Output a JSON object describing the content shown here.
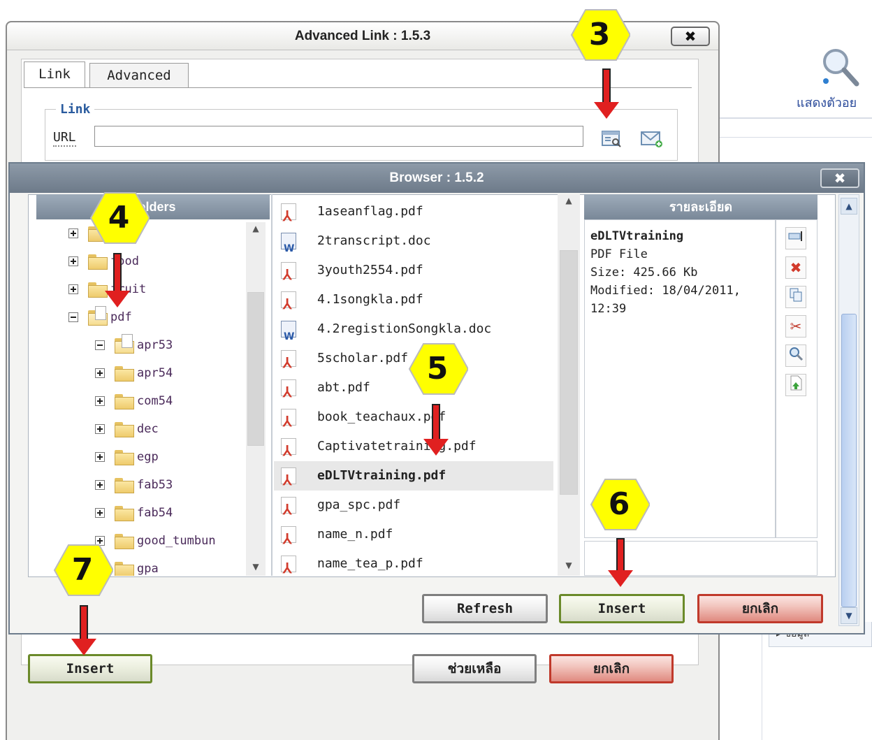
{
  "background": {
    "search_label": "แสดงตัวอย",
    "panel_tab": "ข้อมูล"
  },
  "outer_dialog": {
    "title": "Advanced Link : 1.5.3",
    "close_label": "✖",
    "tabs": [
      {
        "label": "Link"
      },
      {
        "label": "Advanced"
      }
    ],
    "fieldset_legend": "Link",
    "url_label": "URL",
    "url_value": "",
    "insert_label": "Insert",
    "help_label": "ช่วยเหลือ",
    "cancel_label": "ยกเลิก"
  },
  "browser": {
    "title": "Browser : 1.5.2",
    "close_label": "✖",
    "folders_header": "Folders",
    "details_header": "รายละเอียด",
    "tree": [
      {
        "label": "",
        "state": "plus",
        "level": 0
      },
      {
        "label": "food",
        "state": "plus",
        "level": 0
      },
      {
        "label": "fruit",
        "state": "plus",
        "level": 0
      },
      {
        "label": "pdf",
        "state": "minus",
        "level": 0
      },
      {
        "label": "apr53",
        "state": "minus",
        "level": 1
      },
      {
        "label": "apr54",
        "state": "plus",
        "level": 1
      },
      {
        "label": "com54",
        "state": "plus",
        "level": 1
      },
      {
        "label": "dec",
        "state": "plus",
        "level": 1
      },
      {
        "label": "egp",
        "state": "plus",
        "level": 1
      },
      {
        "label": "fab53",
        "state": "plus",
        "level": 1
      },
      {
        "label": "fab54",
        "state": "plus",
        "level": 1
      },
      {
        "label": "good_tumbun",
        "state": "plus",
        "level": 1
      },
      {
        "label": "gpa",
        "state": "plus",
        "level": 1
      }
    ],
    "files": [
      {
        "name": "1aseanflag.pdf",
        "type": "pdf"
      },
      {
        "name": "2transcript.doc",
        "type": "doc"
      },
      {
        "name": "3youth2554.pdf",
        "type": "pdf"
      },
      {
        "name": "4.1songkla.pdf",
        "type": "pdf"
      },
      {
        "name": "4.2registionSongkla.doc",
        "type": "doc"
      },
      {
        "name": "5scholar.pdf",
        "type": "pdf"
      },
      {
        "name": "abt.pdf",
        "type": "pdf"
      },
      {
        "name": "book_teachaux.pdf",
        "type": "pdf"
      },
      {
        "name": "Captivatetraining.pdf",
        "type": "pdf"
      },
      {
        "name": "eDLTVtraining.pdf",
        "type": "pdf",
        "selected": true
      },
      {
        "name": "gpa_spc.pdf",
        "type": "pdf"
      },
      {
        "name": "name_n.pdf",
        "type": "pdf"
      },
      {
        "name": "name_tea_p.pdf",
        "type": "pdf"
      }
    ],
    "details": {
      "name": "eDLTVtraining",
      "type": "PDF File",
      "size": "Size: 425.66 Kb",
      "modified": "Modified: 18/04/2011,",
      "time": "12:39"
    },
    "tools": [
      {
        "icon": "rename-icon"
      },
      {
        "icon": "delete-icon"
      },
      {
        "icon": "copy-icon"
      },
      {
        "icon": "cut-icon"
      },
      {
        "icon": "preview-icon"
      },
      {
        "icon": "upload-icon"
      }
    ],
    "refresh_label": "Refresh",
    "insert_label": "Insert",
    "cancel_label": "ยกเลิก"
  },
  "callouts": [
    {
      "label": "3"
    },
    {
      "label": "4"
    },
    {
      "label": "5"
    },
    {
      "label": "6"
    },
    {
      "label": "7"
    }
  ],
  "colors": {
    "callout_fill": "#ffff00",
    "arrow": "#e02020",
    "link_blue": "#2a5b9e",
    "titlebar": "#798898"
  }
}
